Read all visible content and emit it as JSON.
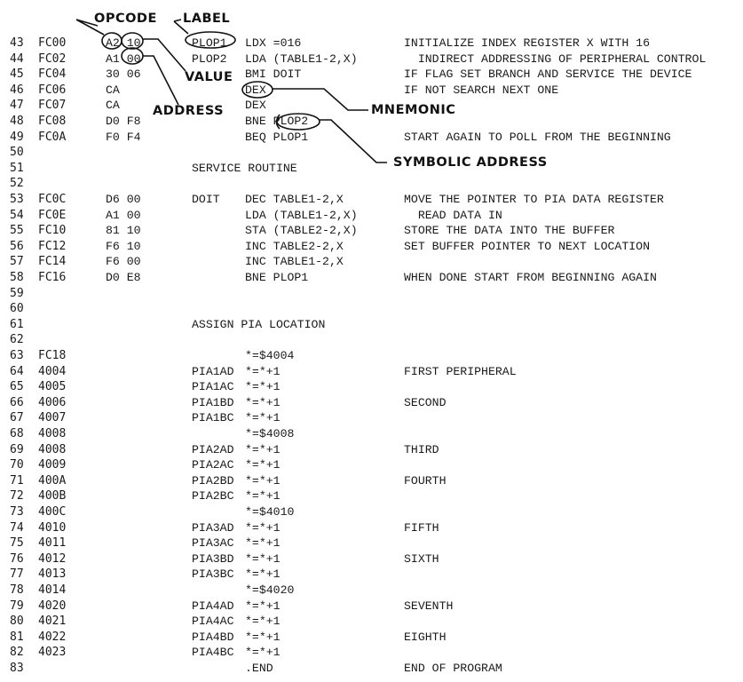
{
  "annotations": {
    "opcode": "OPCODE",
    "label": "LABEL",
    "value": "VALUE",
    "address": "ADDRESS",
    "mnemonic": "MNEMONIC",
    "symbolic_address": "SYMBOLIC ADDRESS"
  },
  "listing": [
    {
      "ln": "43",
      "addr": "FC00",
      "obj": "A2 10",
      "label": "PLOP1",
      "code": "LDX =016",
      "comment": "INITIALIZE INDEX REGISTER X WITH 16"
    },
    {
      "ln": "44",
      "addr": "FC02",
      "obj": "A1 00",
      "label": "PLOP2",
      "code": "LDA (TABLE1-2,X)",
      "comment": "  INDIRECT ADDRESSING OF PERIPHERAL CONTROL"
    },
    {
      "ln": "45",
      "addr": "FC04",
      "obj": "30 06",
      "label": "",
      "code": "BMI DOIT",
      "comment": "IF FLAG SET BRANCH AND SERVICE THE DEVICE"
    },
    {
      "ln": "46",
      "addr": "FC06",
      "obj": "CA",
      "label": "",
      "code": "DEX",
      "comment": "IF NOT SEARCH NEXT ONE"
    },
    {
      "ln": "47",
      "addr": "FC07",
      "obj": "CA",
      "label": "",
      "code": "DEX",
      "comment": ""
    },
    {
      "ln": "48",
      "addr": "FC08",
      "obj": "D0 F8",
      "label": "",
      "code": "BNE PLOP2",
      "comment": ""
    },
    {
      "ln": "49",
      "addr": "FC0A",
      "obj": "F0 F4",
      "label": "",
      "code": "BEQ PLOP1",
      "comment": "START AGAIN TO POLL FROM THE BEGINNING"
    },
    {
      "ln": "50",
      "addr": "",
      "obj": "",
      "label": "",
      "code": "",
      "comment": ""
    },
    {
      "ln": "51",
      "addr": "",
      "obj": "",
      "label": "SERVICE ROUTINE",
      "code": "",
      "comment": ""
    },
    {
      "ln": "52",
      "addr": "",
      "obj": "",
      "label": "",
      "code": "",
      "comment": ""
    },
    {
      "ln": "53",
      "addr": "FC0C",
      "obj": "D6 00",
      "label": "DOIT",
      "code": "DEC TABLE1-2,X",
      "comment": "MOVE THE POINTER TO PIA DATA REGISTER"
    },
    {
      "ln": "54",
      "addr": "FC0E",
      "obj": "A1 00",
      "label": "",
      "code": "LDA (TABLE1-2,X)",
      "comment": "  READ DATA IN"
    },
    {
      "ln": "55",
      "addr": "FC10",
      "obj": "81 10",
      "label": "",
      "code": "STA (TABLE2-2,X)",
      "comment": "STORE THE DATA INTO THE BUFFER"
    },
    {
      "ln": "56",
      "addr": "FC12",
      "obj": "F6 10",
      "label": "",
      "code": "INC TABLE2-2,X",
      "comment": "SET BUFFER POINTER TO NEXT LOCATION"
    },
    {
      "ln": "57",
      "addr": "FC14",
      "obj": "F6 00",
      "label": "",
      "code": "INC TABLE1-2,X",
      "comment": ""
    },
    {
      "ln": "58",
      "addr": "FC16",
      "obj": "D0 E8",
      "label": "",
      "code": "BNE PLOP1",
      "comment": "WHEN DONE START FROM BEGINNING AGAIN"
    },
    {
      "ln": "59",
      "addr": "",
      "obj": "",
      "label": "",
      "code": "",
      "comment": ""
    },
    {
      "ln": "60",
      "addr": "",
      "obj": "",
      "label": "",
      "code": "",
      "comment": ""
    },
    {
      "ln": "61",
      "addr": "",
      "obj": "",
      "label": "ASSIGN PIA LOCATION",
      "code": "",
      "comment": ""
    },
    {
      "ln": "62",
      "addr": "",
      "obj": "",
      "label": "",
      "code": "",
      "comment": ""
    },
    {
      "ln": "63",
      "addr": "FC18",
      "obj": "",
      "label": "",
      "code": "*=$4004",
      "comment": ""
    },
    {
      "ln": "64",
      "addr": "4004",
      "obj": "",
      "label": "PIA1AD",
      "code": "*=*+1",
      "comment": "FIRST PERIPHERAL"
    },
    {
      "ln": "65",
      "addr": "4005",
      "obj": "",
      "label": "PIA1AC",
      "code": "*=*+1",
      "comment": ""
    },
    {
      "ln": "66",
      "addr": "4006",
      "obj": "",
      "label": "PIA1BD",
      "code": "*=*+1",
      "comment": "SECOND"
    },
    {
      "ln": "67",
      "addr": "4007",
      "obj": "",
      "label": "PIA1BC",
      "code": "*=*+1",
      "comment": ""
    },
    {
      "ln": "68",
      "addr": "4008",
      "obj": "",
      "label": "",
      "code": "*=$4008",
      "comment": ""
    },
    {
      "ln": "69",
      "addr": "4008",
      "obj": "",
      "label": "PIA2AD",
      "code": "*=*+1",
      "comment": "THIRD"
    },
    {
      "ln": "70",
      "addr": "4009",
      "obj": "",
      "label": "PIA2AC",
      "code": "*=*+1",
      "comment": ""
    },
    {
      "ln": "71",
      "addr": "400A",
      "obj": "",
      "label": "PIA2BD",
      "code": "*=*+1",
      "comment": "FOURTH"
    },
    {
      "ln": "72",
      "addr": "400B",
      "obj": "",
      "label": "PIA2BC",
      "code": "*=*+1",
      "comment": ""
    },
    {
      "ln": "73",
      "addr": "400C",
      "obj": "",
      "label": "",
      "code": "*=$4010",
      "comment": ""
    },
    {
      "ln": "74",
      "addr": "4010",
      "obj": "",
      "label": "PIA3AD",
      "code": "*=*+1",
      "comment": "FIFTH"
    },
    {
      "ln": "75",
      "addr": "4011",
      "obj": "",
      "label": "PIA3AC",
      "code": "*=*+1",
      "comment": ""
    },
    {
      "ln": "76",
      "addr": "4012",
      "obj": "",
      "label": "PIA3BD",
      "code": "*=*+1",
      "comment": "SIXTH"
    },
    {
      "ln": "77",
      "addr": "4013",
      "obj": "",
      "label": "PIA3BC",
      "code": "*=*+1",
      "comment": ""
    },
    {
      "ln": "78",
      "addr": "4014",
      "obj": "",
      "label": "",
      "code": "*=$4020",
      "comment": ""
    },
    {
      "ln": "79",
      "addr": "4020",
      "obj": "",
      "label": "PIA4AD",
      "code": "*=*+1",
      "comment": "SEVENTH"
    },
    {
      "ln": "80",
      "addr": "4021",
      "obj": "",
      "label": "PIA4AC",
      "code": "*=*+1",
      "comment": ""
    },
    {
      "ln": "81",
      "addr": "4022",
      "obj": "",
      "label": "PIA4BD",
      "code": "*=*+1",
      "comment": "EIGHTH"
    },
    {
      "ln": "82",
      "addr": "4023",
      "obj": "",
      "label": "PIA4BC",
      "code": "*=*+1",
      "comment": ""
    },
    {
      "ln": "83",
      "addr": "",
      "obj": "",
      "label": "",
      "code": ".END",
      "comment": "END OF PROGRAM"
    }
  ]
}
